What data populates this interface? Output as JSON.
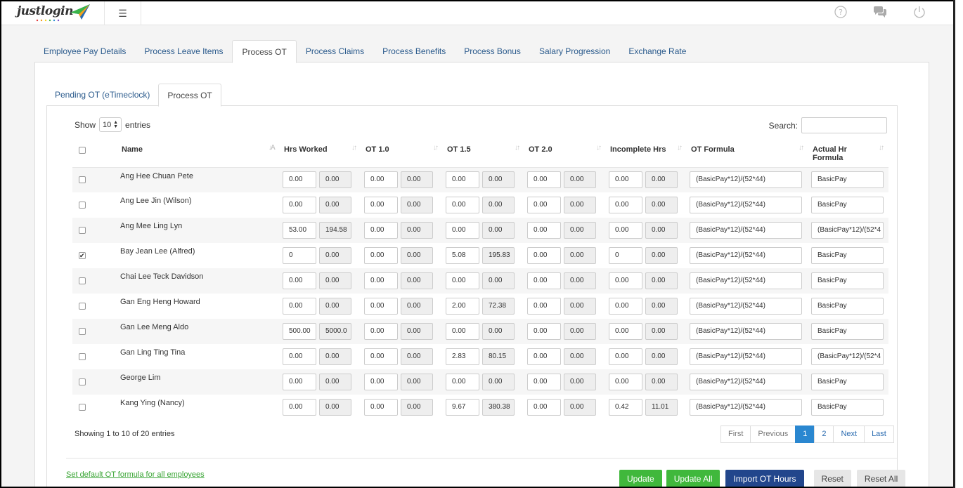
{
  "app": {
    "logo_text": "justlogin"
  },
  "main_tabs": [
    {
      "label": "Employee Pay Details"
    },
    {
      "label": "Process Leave Items"
    },
    {
      "label": "Process OT"
    },
    {
      "label": "Process Claims"
    },
    {
      "label": "Process Benefits"
    },
    {
      "label": "Process Bonus"
    },
    {
      "label": "Salary Progression"
    },
    {
      "label": "Exchange Rate"
    }
  ],
  "sub_tabs": [
    {
      "label": "Pending OT (eTimeclock)"
    },
    {
      "label": "Process OT"
    }
  ],
  "length": {
    "show": "Show",
    "value": "10",
    "entries": "entries"
  },
  "search": {
    "label": "Search:"
  },
  "columns": {
    "name": "Name",
    "hrs_worked": "Hrs Worked",
    "ot10": "OT 1.0",
    "ot15": "OT 1.5",
    "ot20": "OT 2.0",
    "incomplete": "Incomplete Hrs",
    "formula": "OT Formula",
    "actual": "Actual Hr Formula"
  },
  "rows": [
    {
      "checked": false,
      "name": "Ang Hee Chuan Pete",
      "hw": "0.00",
      "hw_v": "0.00",
      "o10": "0.00",
      "o10_v": "0.00",
      "o15": "0.00",
      "o15_v": "0.00",
      "o20": "0.00",
      "o20_v": "0.00",
      "inc": "0.00",
      "inc_v": "0.00",
      "formula": "(BasicPay*12)/(52*44)",
      "actual": "BasicPay"
    },
    {
      "checked": false,
      "name": "Ang Lee Jin (Wilson)",
      "hw": "0.00",
      "hw_v": "0.00",
      "o10": "0.00",
      "o10_v": "0.00",
      "o15": "0.00",
      "o15_v": "0.00",
      "o20": "0.00",
      "o20_v": "0.00",
      "inc": "0.00",
      "inc_v": "0.00",
      "formula": "(BasicPay*12)/(52*44)",
      "actual": "BasicPay"
    },
    {
      "checked": false,
      "name": "Ang Mee Ling Lyn",
      "hw": "53.00",
      "hw_v": "194.58",
      "o10": "0.00",
      "o10_v": "0.00",
      "o15": "0.00",
      "o15_v": "0.00",
      "o20": "0.00",
      "o20_v": "0.00",
      "inc": "0.00",
      "inc_v": "0.00",
      "formula": "(BasicPay*12)/(52*44)",
      "actual": "(BasicPay*12)/(52*4"
    },
    {
      "checked": true,
      "name": "Bay Jean Lee (Alfred)",
      "hw": "0",
      "hw_v": "0.00",
      "o10": "0.00",
      "o10_v": "0.00",
      "o15": "5.08",
      "o15_v": "195.83",
      "o20": "0.00",
      "o20_v": "0.00",
      "inc": "0",
      "inc_v": "0.00",
      "formula": "(BasicPay*12)/(52*44)",
      "actual": "BasicPay"
    },
    {
      "checked": false,
      "name": "Chai Lee Teck Davidson",
      "hw": "0.00",
      "hw_v": "0.00",
      "o10": "0.00",
      "o10_v": "0.00",
      "o15": "0.00",
      "o15_v": "0.00",
      "o20": "0.00",
      "o20_v": "0.00",
      "inc": "0.00",
      "inc_v": "0.00",
      "formula": "(BasicPay*12)/(52*44)",
      "actual": "BasicPay"
    },
    {
      "checked": false,
      "name": "Gan Eng Heng Howard",
      "hw": "0.00",
      "hw_v": "0.00",
      "o10": "0.00",
      "o10_v": "0.00",
      "o15": "2.00",
      "o15_v": "72.38",
      "o20": "0.00",
      "o20_v": "0.00",
      "inc": "0.00",
      "inc_v": "0.00",
      "formula": "(BasicPay*12)/(52*44)",
      "actual": "BasicPay"
    },
    {
      "checked": false,
      "name": "Gan Lee Meng Aldo",
      "hw": "500.00",
      "hw_v": "5000.0",
      "o10": "0.00",
      "o10_v": "0.00",
      "o15": "0.00",
      "o15_v": "0.00",
      "o20": "0.00",
      "o20_v": "0.00",
      "inc": "0.00",
      "inc_v": "0.00",
      "formula": "(BasicPay*12)/(52*44)",
      "actual": "BasicPay"
    },
    {
      "checked": false,
      "name": "Gan Ling Ting Tina",
      "hw": "0.00",
      "hw_v": "0.00",
      "o10": "0.00",
      "o10_v": "0.00",
      "o15": "2.83",
      "o15_v": "80.15",
      "o20": "0.00",
      "o20_v": "0.00",
      "inc": "0.00",
      "inc_v": "0.00",
      "formula": "(BasicPay*12)/(52*44)",
      "actual": "(BasicPay*12)/(52*4"
    },
    {
      "checked": false,
      "name": "George Lim",
      "hw": "0.00",
      "hw_v": "0.00",
      "o10": "0.00",
      "o10_v": "0.00",
      "o15": "0.00",
      "o15_v": "0.00",
      "o20": "0.00",
      "o20_v": "0.00",
      "inc": "0.00",
      "inc_v": "0.00",
      "formula": "(BasicPay*12)/(52*44)",
      "actual": "BasicPay"
    },
    {
      "checked": false,
      "name": "Kang Ying (Nancy)",
      "hw": "0.00",
      "hw_v": "0.00",
      "o10": "0.00",
      "o10_v": "0.00",
      "o15": "9.67",
      "o15_v": "380.38",
      "o20": "0.00",
      "o20_v": "0.00",
      "inc": "0.42",
      "inc_v": "11.01",
      "formula": "(BasicPay*12)/(52*44)",
      "actual": "BasicPay"
    }
  ],
  "info": "Showing 1 to 10 of 20 entries",
  "pagination": {
    "first": "First",
    "previous": "Previous",
    "pages": [
      "1",
      "2"
    ],
    "next": "Next",
    "last": "Last"
  },
  "footer": {
    "default_link": "Set default OT formula for all employees",
    "update": "Update",
    "update_all": "Update All",
    "import": "Import OT Hours",
    "reset": "Reset",
    "reset_all": "Reset All"
  },
  "colors": {
    "link": "#2a5a8c",
    "green": "#40b83c",
    "blue": "#22468c",
    "active_page": "#2a87d0"
  },
  "icons": [
    "hamburger-icon",
    "help-icon",
    "chat-icon",
    "power-icon",
    "sort-icon"
  ]
}
